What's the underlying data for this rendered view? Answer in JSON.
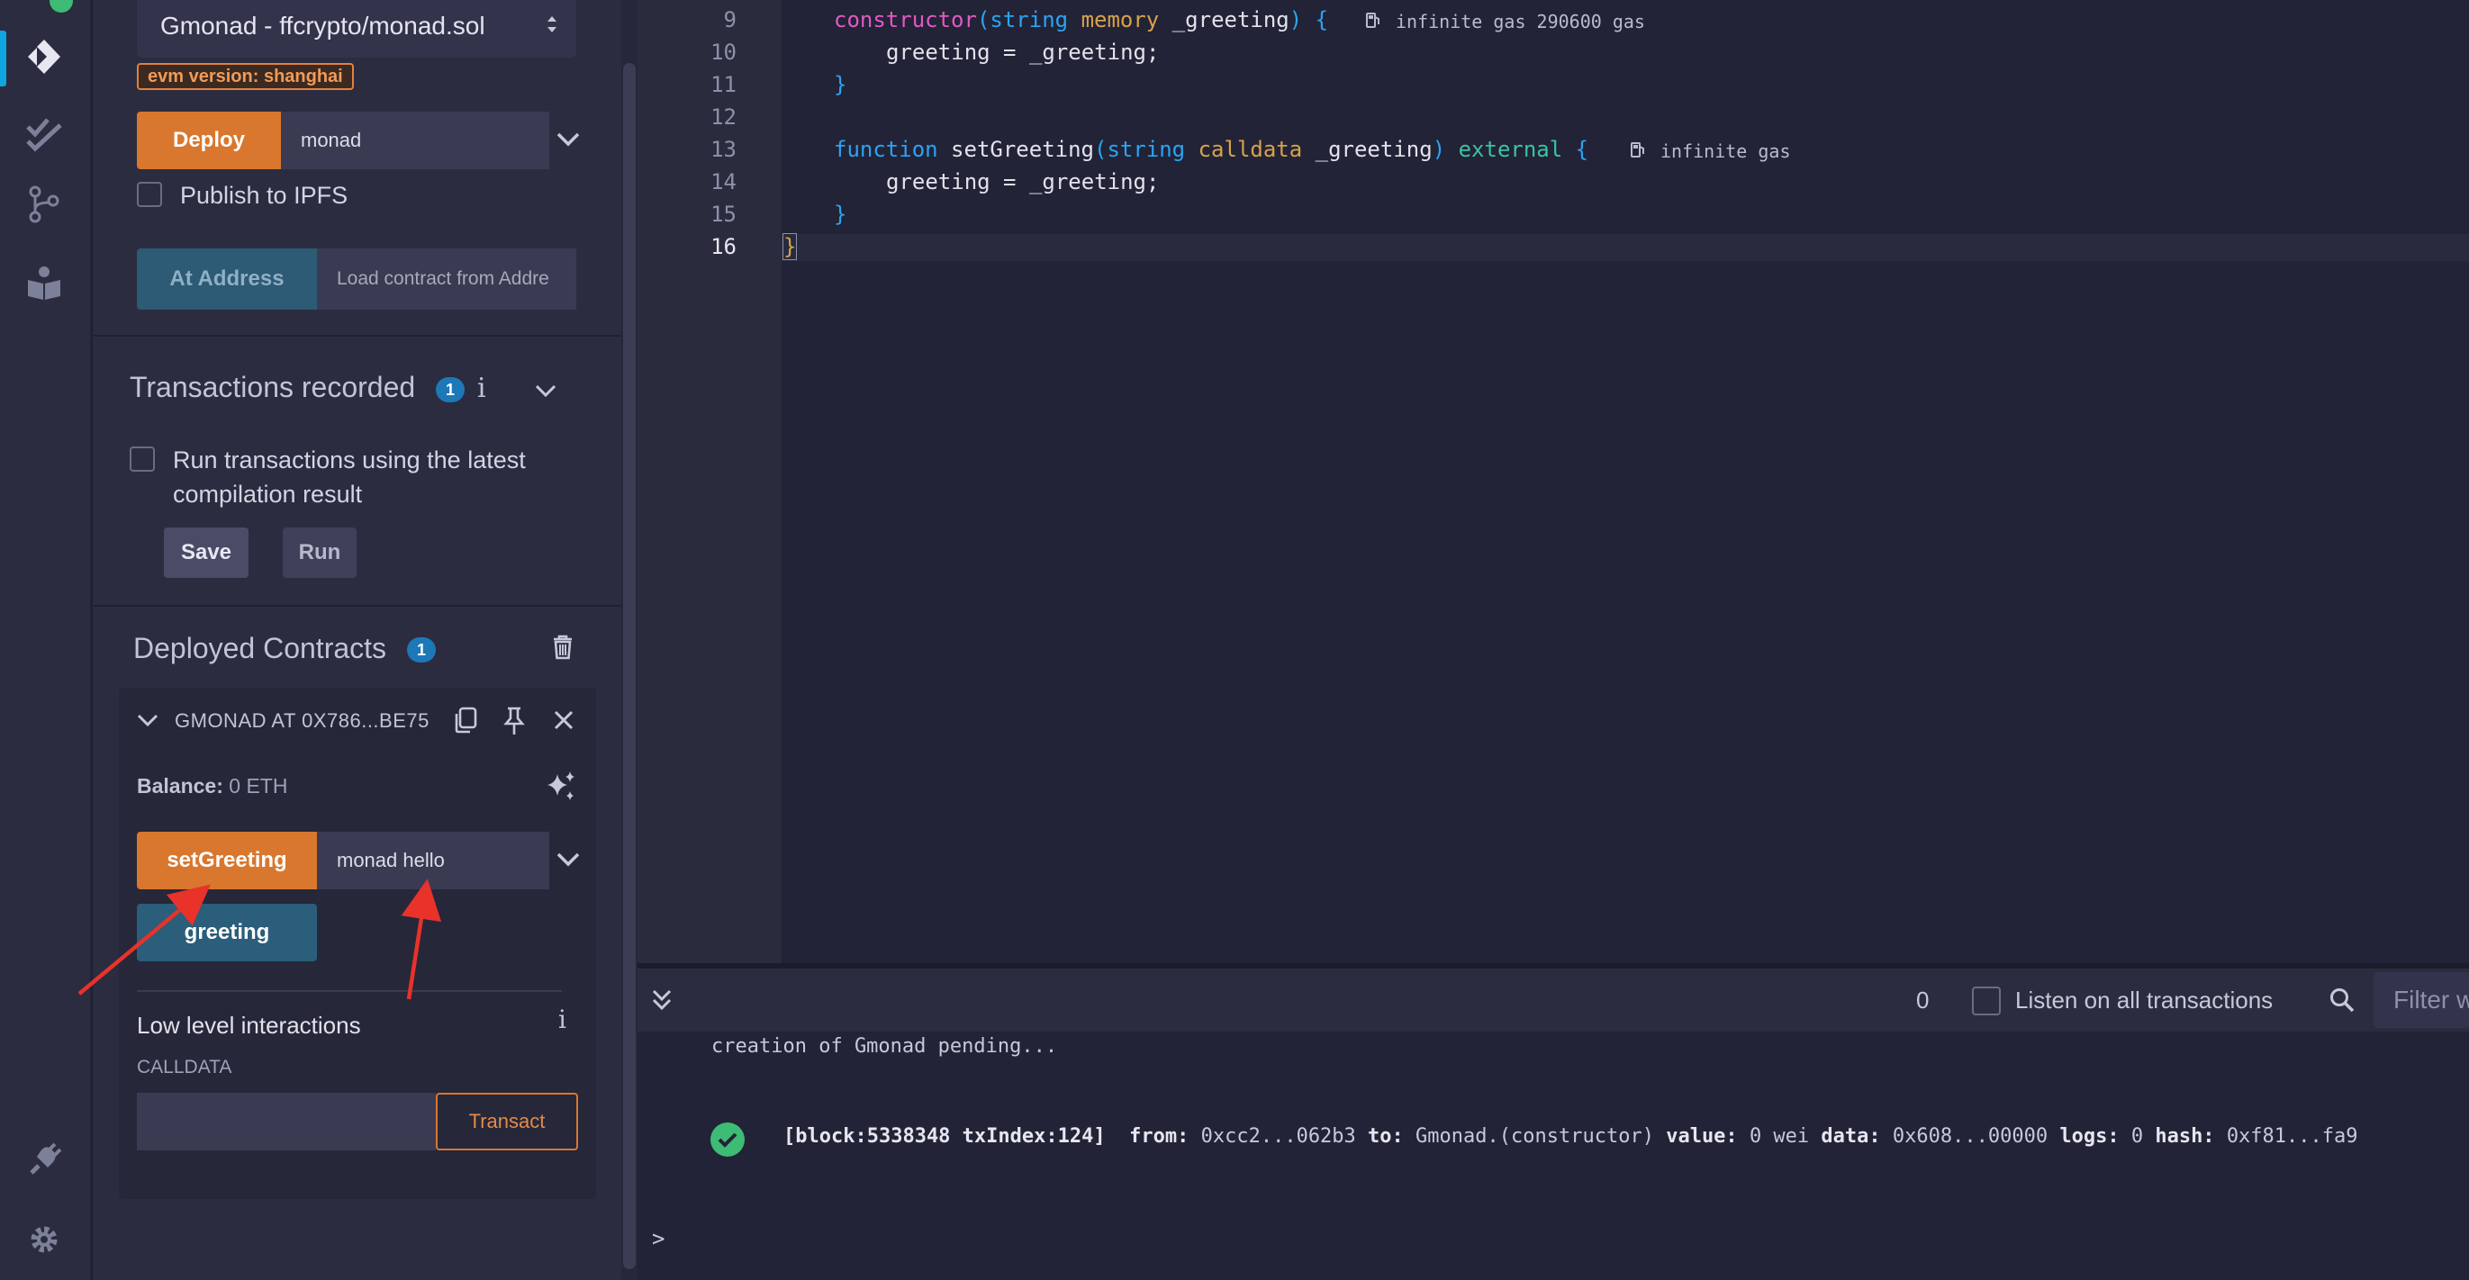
{
  "sidepanel": {
    "contract_select": "Gmonad - ffcrypto/monad.sol",
    "evm_badge": "evm version: shanghai",
    "deploy_label": "Deploy",
    "deploy_input": "monad",
    "publish_ipfs": "Publish to IPFS",
    "at_address_label": "At Address",
    "at_address_placeholder": "Load contract from Addre",
    "transactions_title": "Transactions recorded",
    "transactions_count": "1",
    "info_glyph": "i",
    "run_latest_label": "Run transactions using the latest compilation result",
    "save_label": "Save",
    "run_label": "Run",
    "deployed_title": "Deployed Contracts",
    "deployed_count": "1",
    "instance_name": "GMONAD AT 0X786...BE75",
    "balance_label": "Balance:",
    "balance_value": "0 ETH",
    "set_greeting_label": "setGreeting",
    "set_greeting_input": "monad hello",
    "greeting_label": "greeting",
    "low_level_title": "Low level interactions",
    "calldata_label": "CALLDATA",
    "transact_label": "Transact"
  },
  "editor": {
    "lines": [
      {
        "num": "9"
      },
      {
        "num": "10"
      },
      {
        "num": "11"
      },
      {
        "num": "12"
      },
      {
        "num": "13"
      },
      {
        "num": "14"
      },
      {
        "num": "15"
      },
      {
        "num": "16"
      }
    ],
    "code": {
      "l9_kw": "constructor",
      "l9_paren1": "(",
      "l9_type": "string",
      "l9_mem": "memory",
      "l9_arg": " _greeting",
      "l9_paren2": ")",
      "l9_brace": "{",
      "l10": "greeting = _greeting;",
      "l11": "}",
      "l13_kw": "function",
      "l13_name": " setGreeting",
      "l13_paren1": "(",
      "l13_type": "string",
      "l13_cd": "calldata",
      "l13_arg": " _greeting",
      "l13_paren2": ")",
      "l13_ext": "external",
      "l13_brace": "{",
      "l14": "greeting = _greeting;",
      "l15": "}",
      "l16": "}"
    },
    "gas_hint_1": "infinite gas 290600 gas",
    "gas_hint_2": "infinite gas"
  },
  "terminal": {
    "pending_count": "0",
    "listen_label": "Listen on all transactions",
    "filter_placeholder": "Filter w",
    "pending_line": "creation of Gmonad pending...",
    "tx_block": "[block:5338348 txIndex:124]",
    "from_label": "from:",
    "from_value": "0xcc2...062b3",
    "to_label": "to:",
    "to_value": "Gmonad.(constructor)",
    "value_label": "value:",
    "value_value": "0 wei",
    "data_label": "data:",
    "data_value": "0x608...00000",
    "logs_label": "logs:",
    "logs_value": "0",
    "hash_label": "hash:",
    "hash_value": "0xf81...fa9",
    "prompt": ">"
  },
  "colors": {
    "accent_orange": "#d9772e",
    "accent_blue": "#2a5e7a",
    "success_green": "#3ebb74",
    "annotation_red": "#e8322a"
  }
}
